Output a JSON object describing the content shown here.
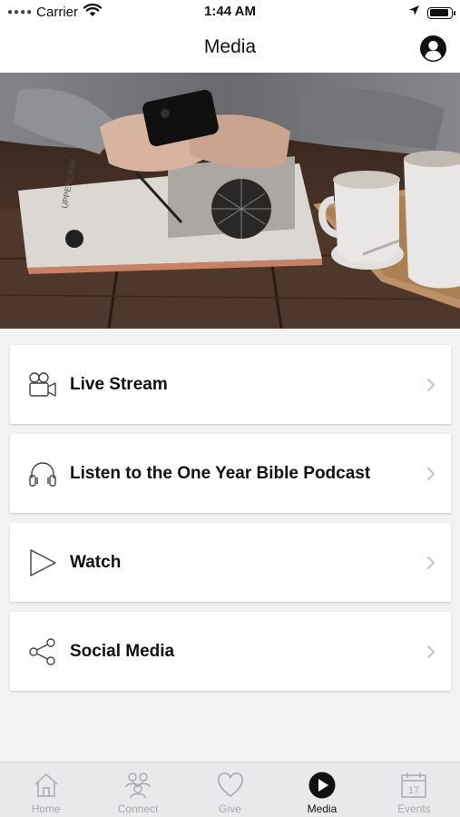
{
  "status_bar": {
    "carrier": "Carrier",
    "time": "1:44 AM",
    "battery_level": 0.9,
    "signal_icon": "signal-dots-icon",
    "wifi_icon": "wifi-icon",
    "location_icon": "location-arrow-icon"
  },
  "header": {
    "title": "Media",
    "profile_icon": "user-circle-icon"
  },
  "hero": {
    "image": "photo of hands holding a smartphone over an UPPERCASE magazine beside coffee cups"
  },
  "menu": {
    "items": [
      {
        "label": "Live Stream",
        "icon": "video-camera-icon"
      },
      {
        "label": "Listen to the One Year Bible Podcast",
        "icon": "headphones-icon"
      },
      {
        "label": "Watch",
        "icon": "play-icon"
      },
      {
        "label": "Social Media",
        "icon": "share-icon"
      }
    ]
  },
  "tab_bar": {
    "active": "Media",
    "tabs": [
      {
        "label": "Home",
        "icon": "home-icon"
      },
      {
        "label": "Connect",
        "icon": "people-icon"
      },
      {
        "label": "Give",
        "icon": "heart-icon"
      },
      {
        "label": "Media",
        "icon": "play-circle-icon"
      },
      {
        "label": "Events",
        "icon": "calendar-icon",
        "icon_text": "17"
      }
    ]
  },
  "colors": {
    "background": "#f2f2f4",
    "card": "#ffffff",
    "text": "#111111",
    "tab_inactive": "#a9a9ad",
    "tab_bar": "#e9e9ec"
  }
}
